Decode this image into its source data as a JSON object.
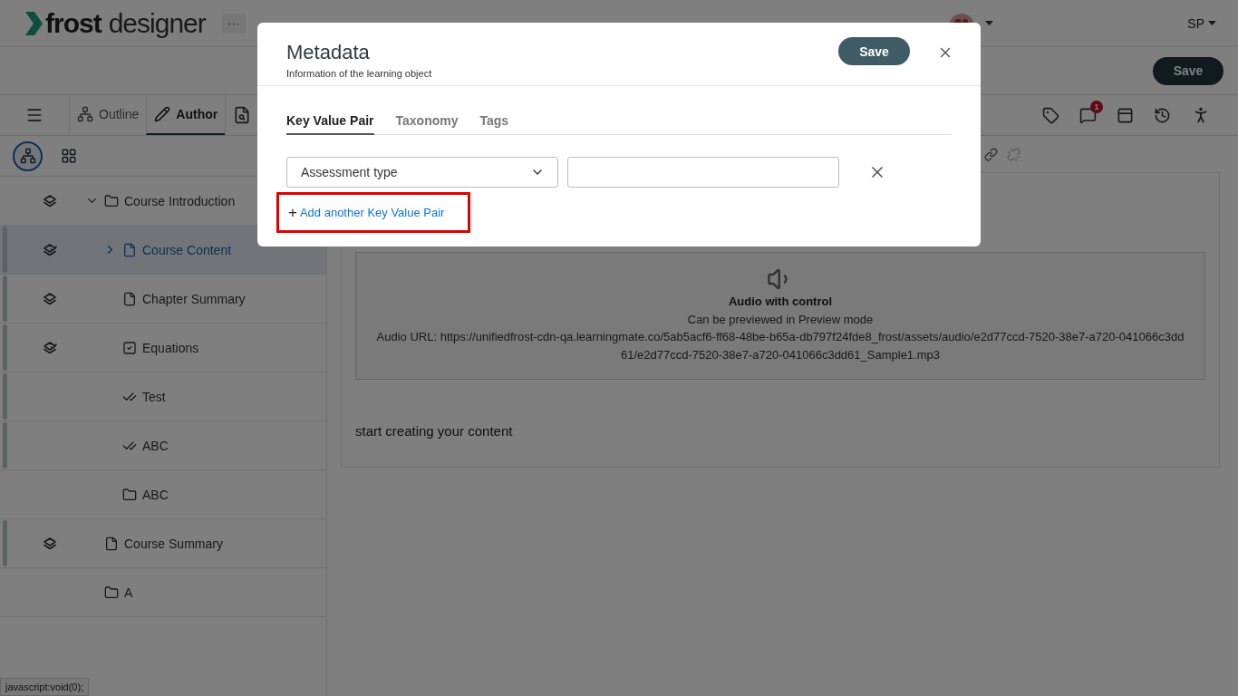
{
  "header": {
    "logo_text_bold": "frost",
    "logo_text": "designer",
    "more_button": "···",
    "user": "SP"
  },
  "save_bar": {
    "save_button": "Save"
  },
  "toolbar": {
    "tabs": [
      {
        "label": "Outline",
        "selected": false
      },
      {
        "label": "Author",
        "selected": true
      }
    ],
    "comment_badge": "1"
  },
  "sidebar": {
    "view_buttons": [
      {
        "kind": "tree",
        "selected": true
      },
      {
        "kind": "widgets",
        "selected": false
      }
    ],
    "items": [
      {
        "label": "Course Introduction",
        "kind": "folder",
        "layered": true,
        "checked": false,
        "flagged": false,
        "selected": false,
        "expanded": true,
        "children": [
          {
            "label": "Course Content",
            "kind": "page",
            "layered": true,
            "checked": true,
            "flagged": true,
            "selected": true,
            "expanded": false
          },
          {
            "label": "Chapter Summary",
            "kind": "page",
            "layered": true,
            "checked": false,
            "flagged": true,
            "selected": false
          },
          {
            "label": "Equations",
            "kind": "assessment",
            "layered": true,
            "checked": true,
            "flagged": true,
            "selected": false
          },
          {
            "label": "Test",
            "kind": "test",
            "layered": false,
            "flagged": true,
            "selected": false
          },
          {
            "label": "ABC",
            "kind": "test",
            "layered": false,
            "flagged": true,
            "selected": false
          },
          {
            "label": "ABC",
            "kind": "folder",
            "layered": false,
            "flagged": false,
            "selected": false
          }
        ]
      },
      {
        "label": "Course Summary",
        "kind": "page",
        "layered": true,
        "checked": false,
        "flagged": true,
        "selected": false
      },
      {
        "label": "A",
        "kind": "folder",
        "layered": false,
        "flagged": false,
        "selected": false
      }
    ]
  },
  "editor": {
    "audio": {
      "title": "Audio with control",
      "note": "Can be previewed in Preview mode",
      "url": "Audio URL: https://unifiedfrost-cdn-qa.learningmate.co/5ab5acf6-ff68-48be-b65a-db797f24fde8_frost/assets/audio/e2d77ccd-7520-38e7-a720-041066c3dd61/e2d77ccd-7520-38e7-a720-041066c3dd61_Sample1.mp3"
    },
    "placeholder": "start creating your content"
  },
  "status_bar": "javascript:void(0);",
  "modal": {
    "title": "Metadata",
    "subtitle": "Information of the learning object",
    "save_button": "Save",
    "tabs": [
      {
        "label": "Key Value Pair",
        "selected": true
      },
      {
        "label": "Taxonomy",
        "selected": false
      },
      {
        "label": "Tags",
        "selected": false
      }
    ],
    "pairs": [
      {
        "key": "Assessment type"
      }
    ],
    "add_link": {
      "plus": "+",
      "label": "Add another Key Value Pair",
      "highlighted": true
    }
  }
}
